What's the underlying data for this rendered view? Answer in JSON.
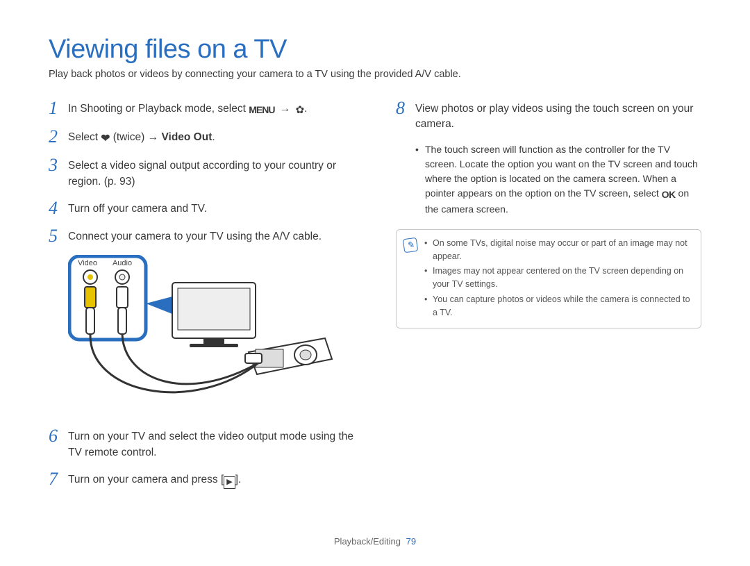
{
  "title": "Viewing files on a TV",
  "subtitle": "Play back photos or videos by connecting your camera to a TV using the provided A/V cable.",
  "diagram": {
    "videoLabel": "Video",
    "audioLabel": "Audio"
  },
  "left": {
    "s1": {
      "n": "1",
      "pre": "In Shooting or Playback mode, select "
    },
    "s2": {
      "n": "2",
      "pre": "Select ",
      "mid": " (twice) → ",
      "bold": "Video Out",
      "post": "."
    },
    "s3": {
      "n": "3",
      "text": "Select a video signal output according to your country or region. (p. 93)"
    },
    "s4": {
      "n": "4",
      "text": "Turn off your camera and TV."
    },
    "s5": {
      "n": "5",
      "text": "Connect your camera to your TV using the A/V cable."
    },
    "s6": {
      "n": "6",
      "text": "Turn on your TV and select the video output mode using the TV remote control."
    },
    "s7": {
      "n": "7",
      "pre": "Turn on your camera and press [",
      "post": "]."
    }
  },
  "right": {
    "s8": {
      "n": "8",
      "text": "View photos or play videos using the touch screen on your camera."
    },
    "sub": {
      "pre": "The touch screen will function as the controller for the TV screen. Locate the option you want on the TV screen and touch where the option is located on the camera screen. When a pointer appears on the option on the TV screen, select ",
      "post": " on the camera screen."
    },
    "notes": {
      "n1": "On some TVs, digital noise may occur or part of an image may not appear.",
      "n2": "Images may not appear centered on the TV screen depending on your TV settings.",
      "n3": "You can capture photos or videos while the camera is connected to a TV."
    }
  },
  "footer": {
    "section": "Playback/Editing",
    "page": "79"
  }
}
